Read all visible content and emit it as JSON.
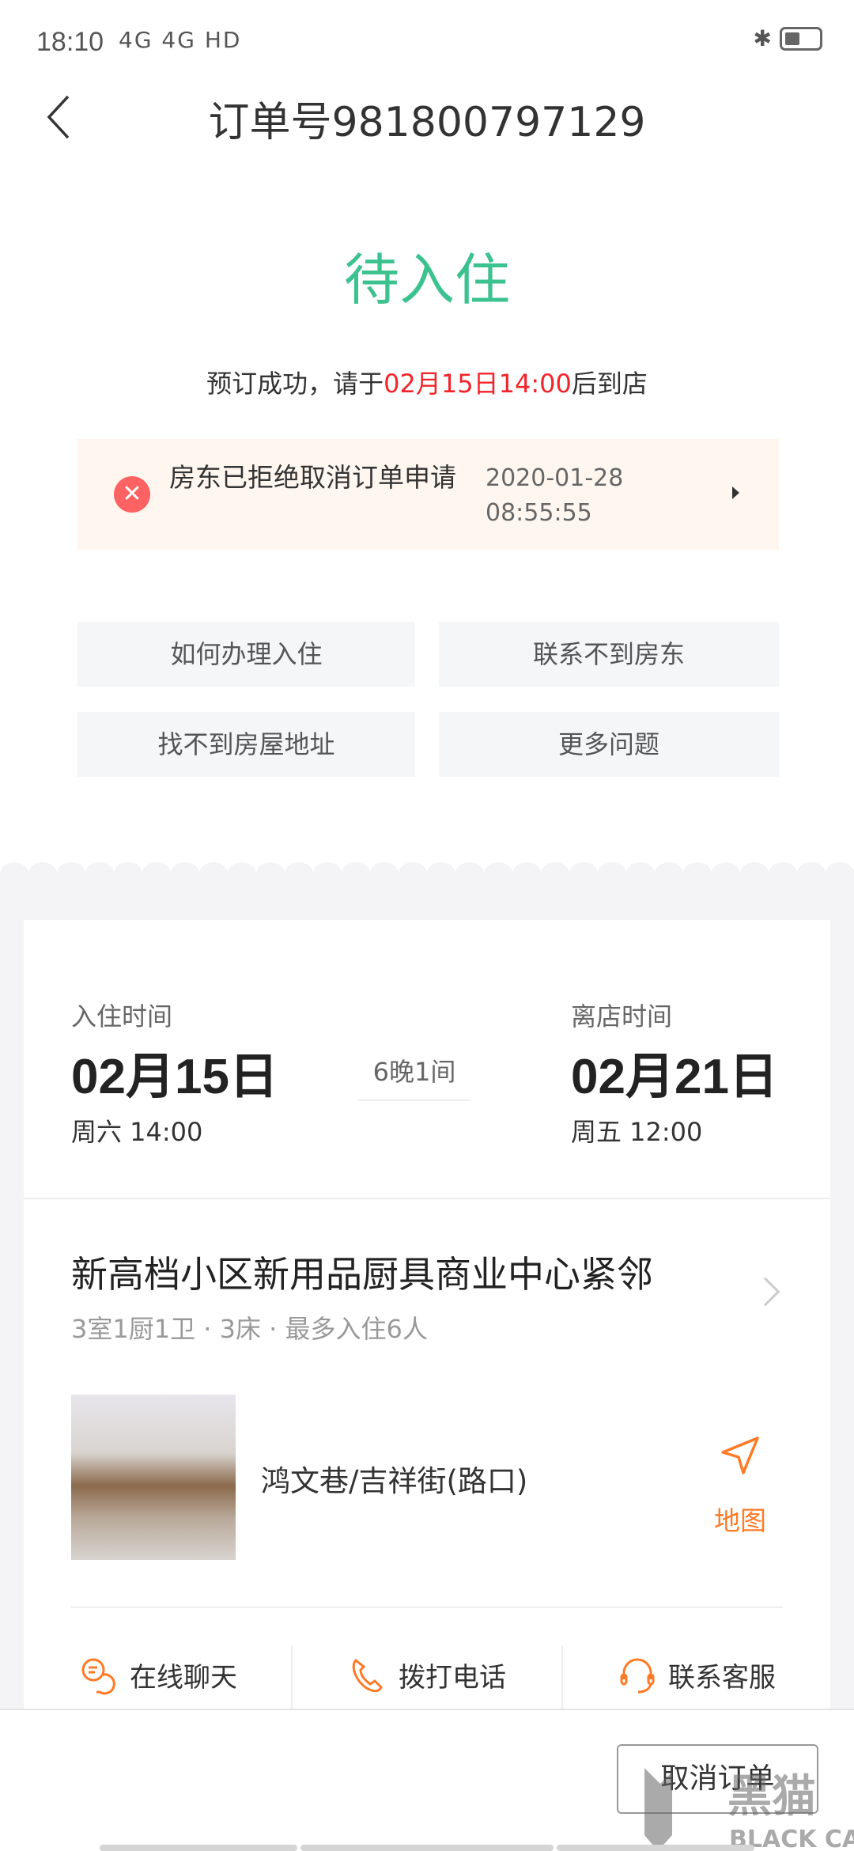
{
  "status_bar": {
    "time": "18:10",
    "network": "4G 4G HD",
    "icons": [
      "signal-icon",
      "signal-icon",
      "wifi-icon",
      "bluetooth-icon",
      "battery-icon"
    ]
  },
  "header": {
    "title": "订单号981800797129"
  },
  "order": {
    "state": "待入住",
    "tip_prefix": "预订成功，请于",
    "tip_time": "02月15日14:00",
    "tip_suffix": "后到店",
    "state_color": "#3bc28f",
    "highlight_color": "#f2242b"
  },
  "notice": {
    "message": "房东已拒绝取消订单申请",
    "date": "2020-01-28",
    "time": "08:55:55"
  },
  "quick_questions": [
    "如何办理入住",
    "联系不到房东",
    "找不到房屋地址",
    "更多问题"
  ],
  "stay": {
    "checkin_label": "入住时间",
    "checkin_date": "02月15日",
    "checkin_time": "周六 14:00",
    "nights": "6晚1间",
    "checkout_label": "离店时间",
    "checkout_date": "02月21日",
    "checkout_time": "周五 12:00"
  },
  "house": {
    "title": "新高档小区新用品厨具商业中心紧邻",
    "details": "3室1厨1卫 · 3床 · 最多入住6人",
    "address": "鸿文巷/吉祥街(路口)",
    "map_label": "地图"
  },
  "actions": [
    "在线聊天",
    "拨打电话",
    "联系客服"
  ],
  "bottom": {
    "cancel_label": "取消订单"
  },
  "watermark": {
    "text": "黑猫 BLACK CAT"
  },
  "accent_color": "#ff7a26"
}
